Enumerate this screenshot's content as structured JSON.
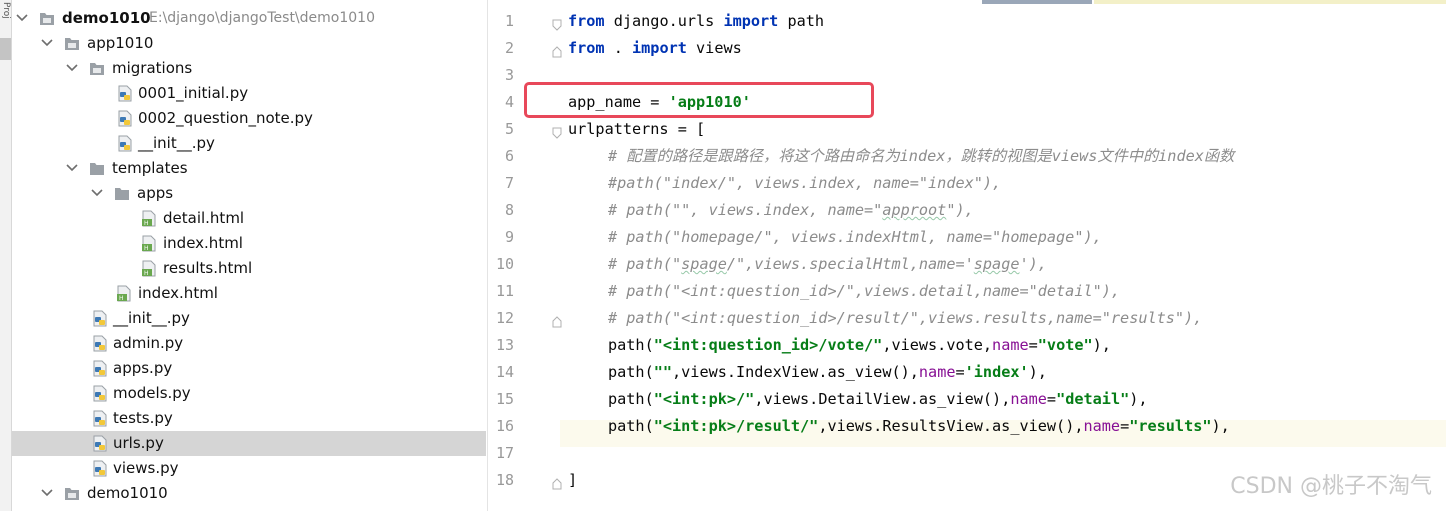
{
  "tool_strip": {
    "label": "Proj"
  },
  "project_tree": {
    "rows": [
      {
        "name": "demo1010",
        "path": "E:\\django\\djangoTest\\demo1010"
      },
      {
        "name": "app1010"
      },
      {
        "name": "migrations"
      },
      {
        "name": "0001_initial.py"
      },
      {
        "name": "0002_question_note.py"
      },
      {
        "name": "__init__.py"
      },
      {
        "name": "templates"
      },
      {
        "name": "apps"
      },
      {
        "name": "detail.html"
      },
      {
        "name": "index.html"
      },
      {
        "name": "results.html"
      },
      {
        "name": "index.html"
      },
      {
        "name": "__init__.py"
      },
      {
        "name": "admin.py"
      },
      {
        "name": "apps.py"
      },
      {
        "name": "models.py"
      },
      {
        "name": "tests.py"
      },
      {
        "name": "urls.py"
      },
      {
        "name": "views.py"
      },
      {
        "name": "demo1010"
      }
    ]
  },
  "editor": {
    "line_numbers": [
      "1",
      "2",
      "3",
      "4",
      "5",
      "6",
      "7",
      "8",
      "9",
      "10",
      "11",
      "12",
      "13",
      "14",
      "15",
      "16",
      "17",
      "18"
    ],
    "lines": {
      "l1": {
        "k1": "from",
        "t1": " django.urls ",
        "k2": "import",
        "t2": " path"
      },
      "l2": {
        "k1": "from",
        "t1": " . ",
        "k2": "import",
        "t2": " views"
      },
      "l4": {
        "t1": "app_name = ",
        "s1": "'app1010'"
      },
      "l5": {
        "t1": "urlpatterns = ["
      },
      "l6": {
        "c1": "# 配置的路径是跟路径，将这个路由命名为index，跳转的视图是views文件中的index函数"
      },
      "l7": {
        "c1": "#path(\"index/\", views.index, name=\"index\"),"
      },
      "l8": {
        "c1": "# path(\"\", views.index, name=\"",
        "c2": "approot",
        "c3": "\"),"
      },
      "l9": {
        "c1": "# path(\"homepage/\", views.indexHtml, name=\"homepage\"),"
      },
      "l10": {
        "c1": "# path(\"",
        "c2": "spage",
        "c3": "/\",views.specialHtml,name='",
        "c4": "spage",
        "c5": "'),"
      },
      "l11": {
        "c1": "# path(\"<int:question_id>/\",views.detail,name=\"detail\"),"
      },
      "l12": {
        "c1": "# path(\"<int:question_id>/result/\",views.results,name=\"results\"),"
      },
      "l13": {
        "t1": "path(",
        "s1": "\"<int:question_id>/vote/\"",
        "t2": ",views.vote,",
        "n1": "name",
        "t3": "=",
        "s2": "\"vote\"",
        "t4": "),"
      },
      "l14": {
        "t1": "path(",
        "s1": "\"\"",
        "t2": ",views.IndexView.as_view(),",
        "n1": "name",
        "t3": "=",
        "s2": "'index'",
        "t4": "),"
      },
      "l15": {
        "t1": "path(",
        "s1": "\"<int:pk>/\"",
        "t2": ",views.DetailView.as_view(),",
        "n1": "name",
        "t3": "=",
        "s2": "\"detail\"",
        "t4": "),"
      },
      "l16": {
        "t1": "path(",
        "s1": "\"<int:pk>/result/\"",
        "t2": ",views.ResultsView.as_view(),",
        "n1": "name",
        "t3": "=",
        "s2": "\"results\"",
        "t4": "),"
      },
      "l18": {
        "t1": "]"
      }
    },
    "current_line": 16
  },
  "watermark": "CSDN @桃子不淘气",
  "colors": {
    "keyword": "#0033b3",
    "string": "#067d17",
    "named_arg": "#871094",
    "comment": "#8c8c8c",
    "highlight_box": "#e8485a",
    "selected_row": "#d5d5d5",
    "current_line": "#fcfaed"
  },
  "icons": {
    "expand": "chevron-down-icon",
    "folder": "folder-icon",
    "python_file": "python-file-icon",
    "html_file": "html-file-icon"
  }
}
